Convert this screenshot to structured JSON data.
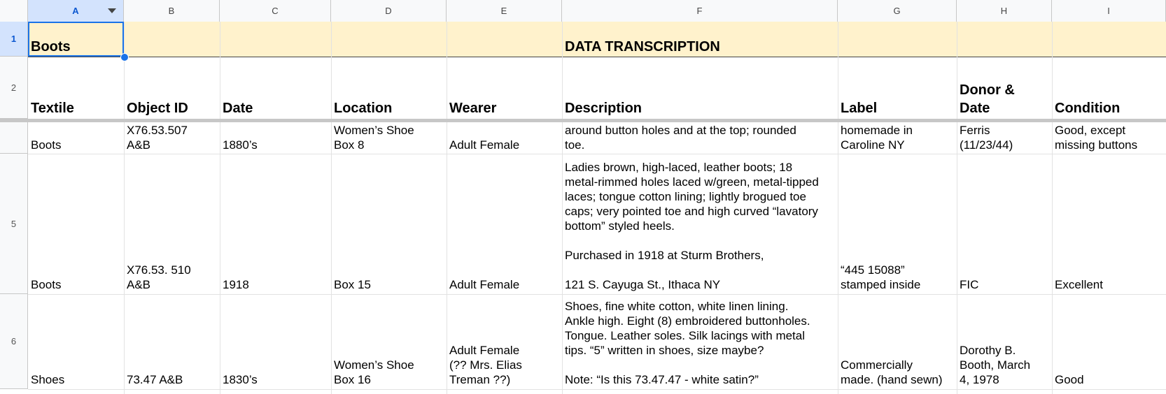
{
  "columns": [
    "A",
    "B",
    "C",
    "D",
    "E",
    "F",
    "G",
    "H",
    "I"
  ],
  "rows": [
    "1",
    "2",
    "",
    "5",
    "6"
  ],
  "title_row": {
    "a": "Boots",
    "f": "DATA TRANSCRIPTION"
  },
  "headers": [
    "Textile",
    "Object ID",
    "Date",
    "Location",
    "Wearer",
    "Description",
    "Label",
    "Donor &\nDate",
    "Condition"
  ],
  "records": [
    [
      "Boots",
      "X76.53.507\nA&B",
      "1880’s",
      "Women’s Shoe\nBox 8",
      "Adult Female",
      "around button holes and at the top; rounded\ntoe.",
      "homemade in\nCaroline NY",
      "Ferris\n(11/23/44)",
      "Good, except\nmissing buttons"
    ],
    [
      "Boots",
      "X76.53. 510\nA&B",
      "1918",
      "Box 15",
      "Adult Female",
      "Ladies brown, high-laced, leather boots; 18\nmetal-rimmed holes laced w/green, metal-tipped\nlaces; tongue cotton lining; lightly brogued toe\ncaps; very pointed toe and high curved “lavatory\nbottom” styled heels.\n\nPurchased in 1918 at Sturm Brothers,\n\n121 S. Cayuga St., Ithaca NY",
      "“445 15088”\nstamped inside",
      "FIC",
      "Excellent"
    ],
    [
      "Shoes",
      "73.47 A&B",
      "1830’s",
      "Women’s Shoe\nBox 16",
      "Adult Female\n(?? Mrs. Elias\nTreman ??)",
      "Shoes, fine white cotton, white linen lining.\nAnkle high. Eight (8) embroidered buttonholes.\nTongue. Leather soles. Silk lacings with metal\ntips. “5” written in shoes, size maybe?\n\nNote: “Is this 73.47.47 - white satin?”",
      "Commercially\nmade. (hand sewn)",
      "Dorothy B.\nBooth, March\n4, 1978",
      "Good"
    ]
  ],
  "colors": {
    "title_fill": "#fff2cc",
    "selection": "#1a73e8",
    "header_select": "#d3e3fd"
  }
}
